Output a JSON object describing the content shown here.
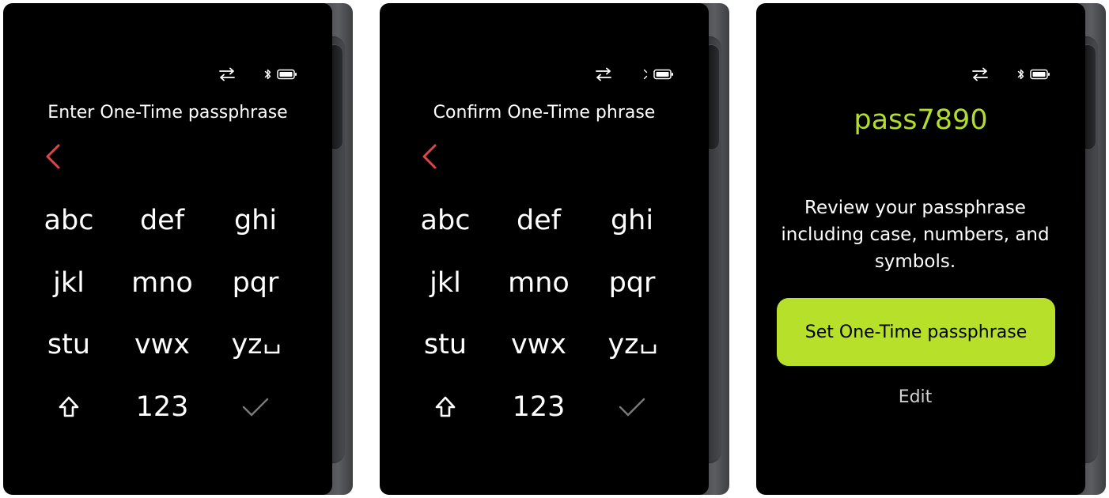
{
  "colors": {
    "screen_bg": "#000000",
    "text": "#ffffff",
    "back_arrow": "#e0454c",
    "accent_green": "#b6e02a",
    "passphrase_green": "#b2dc2e",
    "muted_check": "#7a7a7a",
    "device_frame": "#4d4e52"
  },
  "status_icons": [
    "usb-transfer-icon",
    "bluetooth-icon",
    "battery-icon"
  ],
  "screens": [
    {
      "title": "Enter One-Time passphrase",
      "keys": [
        "abc",
        "def",
        "ghi",
        "jkl",
        "mno",
        "pqr",
        "stu",
        "vwx",
        "yz"
      ],
      "numeric_key": "123",
      "icons": [
        "back-chevron-icon",
        "shift-arrow-icon",
        "space-icon",
        "confirm-check-icon"
      ]
    },
    {
      "title": "Confirm One-Time phrase",
      "keys": [
        "abc",
        "def",
        "ghi",
        "jkl",
        "mno",
        "pqr",
        "stu",
        "vwx",
        "yz"
      ],
      "numeric_key": "123",
      "icons": [
        "back-chevron-icon",
        "shift-arrow-icon",
        "space-icon",
        "confirm-check-icon"
      ]
    },
    {
      "passphrase": "pass7890",
      "review_text": "Review your passphrase including case, numbers, and symbols.",
      "primary_button": "Set One-Time passphrase",
      "secondary_link": "Edit"
    }
  ]
}
